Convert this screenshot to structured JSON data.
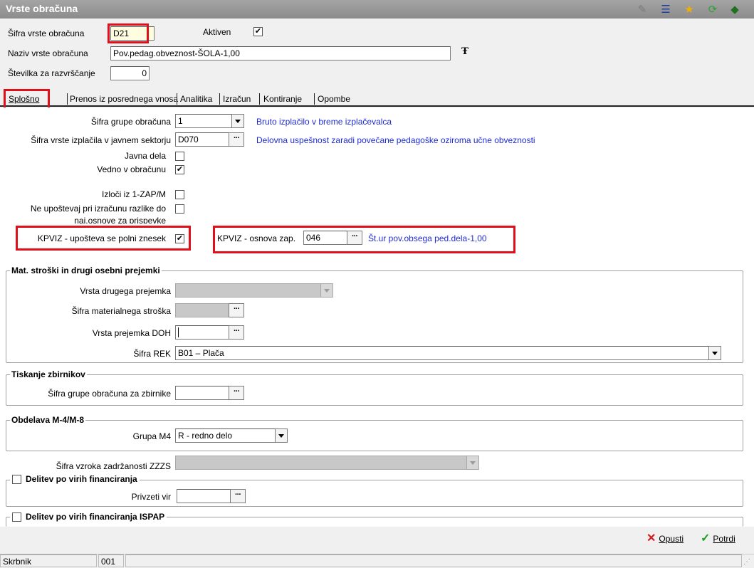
{
  "window": {
    "title": "Vrste obračuna"
  },
  "header": {
    "code_label": "Šifra vrste obračuna",
    "code_value": "D21",
    "active_label": "Aktiven",
    "active_checked": "✔",
    "name_label": "Naziv vrste obračuna",
    "name_value": "Pov.pedag.obveznost-ŠOLA-1,00",
    "order_label": "Številka  za razvrščanje",
    "order_value": "0"
  },
  "tabs": [
    "Splošno",
    "Prenos iz posrednega vnosa",
    "Analitika",
    "Izračun",
    "Kontiranje",
    "Opombe"
  ],
  "general": {
    "group_label": "Šifra grupe obračuna",
    "group_value": "1",
    "group_desc": "Bruto izplačilo v breme izplačevalca",
    "payment_type_label": "Šifra vrste izplačila v javnem sektorju",
    "payment_type_value": "D070",
    "payment_type_desc": "Delovna uspešnost zaradi povečane pedagoške oziroma učne obveznosti",
    "public_works_label": "Javna dela",
    "always_label": "Vedno v obračunu",
    "always_checked": "✔",
    "exclude_label": "Izloči iz 1-ZAP/M",
    "ignore_label_1": "Ne upoštevaj pri izračunu razlike do",
    "ignore_label_2": "naj.osnove za prispevke",
    "kpviz_full_label": "KPVIZ - upošteva se polni znesek",
    "kpviz_full_checked": "✔",
    "kpviz_base_label": "KPVIZ - osnova zap.",
    "kpviz_base_value": "046",
    "kpviz_base_desc": "Št.ur pov.obsega ped.dela-1,00"
  },
  "mat_group": {
    "title": "Mat. stroški in drugi osebni prejemki",
    "other_receipt_label": "Vrsta drugega prejemka",
    "material_cost_label": "Šifra materialnega stroška",
    "doh_label": "Vrsta prejemka DOH",
    "rek_label": "Šifra REK",
    "rek_value": "B01 – Plača"
  },
  "print_group": {
    "title": "Tiskanje zbirnikov",
    "group_label": "Šifra grupe obračuna za zbirnike"
  },
  "m4_group": {
    "title": "Obdelava M-4/M-8",
    "group_label": "Grupa M4",
    "group_value": "R - redno delo"
  },
  "zzzs": {
    "label": "Šifra vzroka zadržanosti ZZZS"
  },
  "financing": {
    "title": "Delitev po virih financiranja",
    "source_label": "Privzeti vir"
  },
  "financing_ispap": {
    "title": "Delitev po virih financiranja ISPAP"
  },
  "dots": "···",
  "footer": {
    "cancel_label": "Opusti",
    "confirm_label": "Potrdi"
  },
  "statusbar": {
    "user": "Skrbnik",
    "code": "001"
  },
  "colors": {
    "highlight": "#e0101a",
    "link": "#1f2bd6",
    "titlebar": "#9a9a9a"
  }
}
